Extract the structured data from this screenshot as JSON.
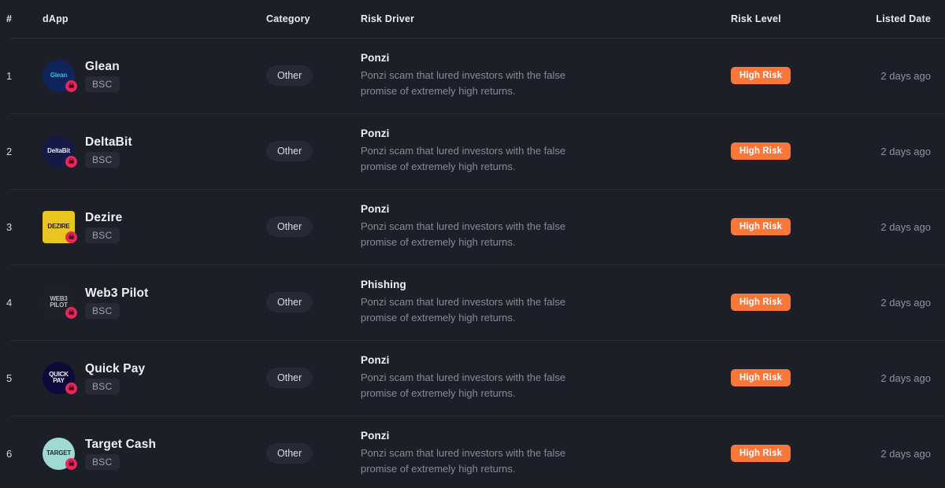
{
  "table": {
    "columns": {
      "index": "#",
      "dapp": "dApp",
      "category": "Category",
      "risk_driver": "Risk Driver",
      "risk_level": "Risk Level",
      "listed_date": "Listed Date"
    },
    "accent_colors": {
      "risk_badge_bg": "#f97839",
      "risk_badge_text": "#ffffff",
      "page_bg": "#1c1f27",
      "divider": "#2b2f38",
      "muted_text": "#848b9b"
    },
    "rows": [
      {
        "index": "1",
        "name": "Glean",
        "logo_text": "Glean",
        "logo_bg": "#10245c",
        "logo_fg": "#23c7e8",
        "logo_shape": "circle",
        "badge_icon": "skull-icon",
        "chain": "BSC",
        "category": "Other",
        "driver_title": "Ponzi",
        "driver_desc": "Ponzi scam that lured investors with the false promise of extremely high returns.",
        "risk_level": "High Risk",
        "listed_date": "2 days ago"
      },
      {
        "index": "2",
        "name": "DeltaBit",
        "logo_text": "DeltaBit",
        "logo_bg": "#141a45",
        "logo_fg": "#e7e9f3",
        "logo_shape": "circle",
        "badge_icon": "skull-icon",
        "chain": "BSC",
        "category": "Other",
        "driver_title": "Ponzi",
        "driver_desc": "Ponzi scam that lured investors with the false promise of extremely high returns.",
        "risk_level": "High Risk",
        "listed_date": "2 days ago"
      },
      {
        "index": "3",
        "name": "Dezire",
        "logo_text": "DEZIRE",
        "logo_bg": "#e8c520",
        "logo_fg": "#1a1a1a",
        "logo_shape": "square",
        "badge_icon": "skull-icon",
        "chain": "BSC",
        "category": "Other",
        "driver_title": "Ponzi",
        "driver_desc": "Ponzi scam that lured investors with the false promise of extremely high returns.",
        "risk_level": "High Risk",
        "listed_date": "2 days ago"
      },
      {
        "index": "4",
        "name": "Web3 Pilot",
        "logo_text": "WEB3 PILOT",
        "logo_bg": "#1f2128",
        "logo_fg": "#b9bdc7",
        "logo_shape": "circle",
        "badge_icon": "skull-icon",
        "chain": "BSC",
        "category": "Other",
        "driver_title": "Phishing",
        "driver_desc": "Ponzi scam that lured investors with the false promise of extremely high returns.",
        "risk_level": "High Risk",
        "listed_date": "2 days ago"
      },
      {
        "index": "5",
        "name": "Quick Pay",
        "logo_text": "QUICK PAY",
        "logo_bg": "#0b0a3a",
        "logo_fg": "#f2f3f8",
        "logo_shape": "circle",
        "badge_icon": "skull-icon",
        "chain": "BSC",
        "category": "Other",
        "driver_title": "Ponzi",
        "driver_desc": "Ponzi scam that lured investors with the false promise of extremely high returns.",
        "risk_level": "High Risk",
        "listed_date": "2 days ago"
      },
      {
        "index": "6",
        "name": "Target Cash",
        "logo_text": "TARGET",
        "logo_bg": "#9fd9d2",
        "logo_fg": "#1d2b33",
        "logo_shape": "circle",
        "badge_icon": "skull-icon",
        "chain": "BSC",
        "category": "Other",
        "driver_title": "Ponzi",
        "driver_desc": "Ponzi scam that lured investors with the false promise of extremely high returns.",
        "risk_level": "High Risk",
        "listed_date": "2 days ago"
      }
    ]
  }
}
